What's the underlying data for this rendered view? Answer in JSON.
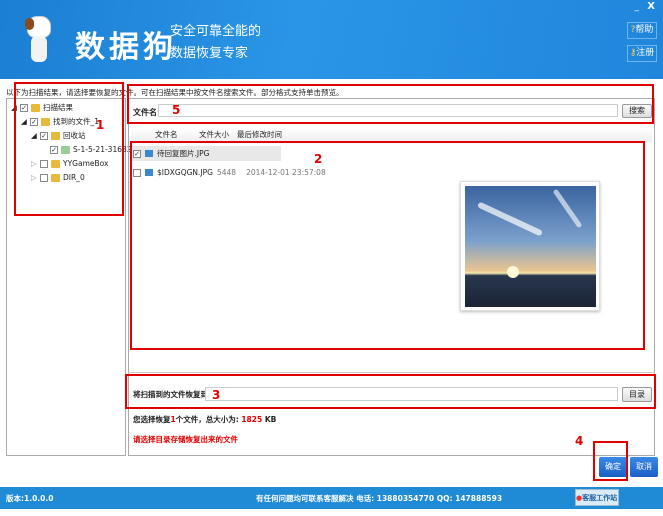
{
  "header": {
    "app_name": "数据狗",
    "slogan_line1": "安全可靠全能的",
    "slogan_line2": "数据恢复专家",
    "minimize": "_",
    "close": "X",
    "help": "帮助",
    "register": "注册"
  },
  "instruction": "以下为扫描结果，请选择要恢复的文件。可在扫描结果中按文件名搜索文件。部分格式支持单击预览。",
  "tree": [
    {
      "label": "扫描结果"
    },
    {
      "label": "找到的文件_1"
    },
    {
      "label": "回收站"
    },
    {
      "label": "S-1-5-21-3168262..."
    },
    {
      "label": "YYGameBox"
    },
    {
      "label": "DIR_0"
    }
  ],
  "search": {
    "label": "文件名:",
    "value": "",
    "button": "搜索"
  },
  "columns": [
    "文件名",
    "文件大小",
    "最后修改时间"
  ],
  "files": [
    {
      "name": "待回复图片.JPG",
      "size": "",
      "time": ""
    },
    {
      "name": "$IDXGQGN.JPG",
      "size": "5448",
      "time": "2014-12-01 23:57:08"
    }
  ],
  "restore": {
    "label": "将扫描到的文件恢复到:",
    "value": "",
    "button": "目录"
  },
  "summary": {
    "prefix": "您选择恢复",
    "count": "1",
    "middle": "个文件，总大小为:",
    "size": "1825",
    "unit": "KB"
  },
  "warning": "请选择目录存储恢复出来的文件",
  "buttons": {
    "ok": "确定",
    "cancel": "取消"
  },
  "footer": {
    "version": "版本:1.0.0.0",
    "contact": "有任何问题均可联系客服解决 电话: 13880354770 QQ: 147888593",
    "service": "客服工作站"
  },
  "annotations": [
    "1",
    "2",
    "3",
    "4",
    "5"
  ],
  "colors": {
    "header": "#1f86dc",
    "accent_red": "#e00000",
    "button_blue": "#1f6fd0"
  }
}
